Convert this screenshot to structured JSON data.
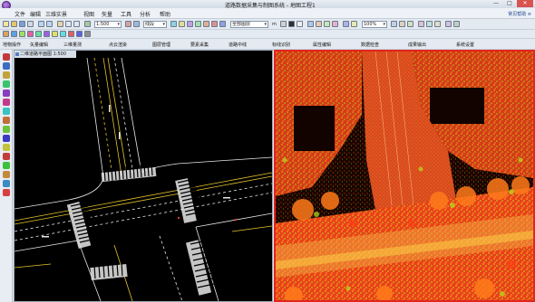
{
  "window": {
    "title": "道路数据采集与制图系统 - 地图工程1"
  },
  "window_controls": {
    "minimize": "—",
    "maximize": "□",
    "close": "✕"
  },
  "menu": {
    "items": [
      "文件",
      "编辑",
      "三维实景",
      "视图",
      "矢量",
      "工具",
      "分析",
      "帮助"
    ],
    "help_link": "常见帮助 ≡"
  },
  "toolbar": {
    "scale_value": "1:500",
    "mode_value": "线段",
    "layer_value": "全部图层",
    "unit_label": "m",
    "zoom_value": "100%",
    "text_buttons": [
      "地物操作",
      "矢量编辑",
      "三维量测",
      "点云渲染",
      "图层管理",
      "要素采集",
      "道路中线",
      "标线识别",
      "属性编辑",
      "数据检查",
      "成果输出",
      "系统设置"
    ]
  },
  "left_panel": {
    "tab_title": "二维道路平面图 1:500"
  },
  "colors": {
    "road_line_white": "#e8e8e8",
    "road_line_yellow": "#e6c42a",
    "pointcloud_high": "#ff3a12",
    "pointcloud_mid": "#ff8a1a",
    "pointcloud_low": "#b7e21c",
    "active_border": "#e0261c"
  }
}
